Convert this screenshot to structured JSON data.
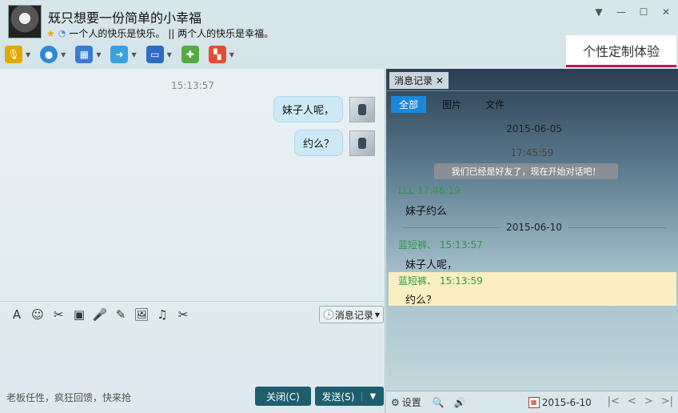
{
  "header": {
    "title": "兓只想要一份简单的小幸福",
    "signature": "一个人的快乐是快乐。  ||  两个人的快乐是幸福。",
    "window_buttons": [
      "▼",
      "—",
      "☐",
      "✕"
    ]
  },
  "toolbar": {
    "items": [
      {
        "name": "voice-call",
        "icon": "🎙",
        "color": "#e0a800"
      },
      {
        "name": "video-call",
        "icon": "●",
        "color": "#2e8bd6"
      },
      {
        "name": "screen-share",
        "icon": "▦",
        "color": "#3b7bd1"
      },
      {
        "name": "file-transfer",
        "icon": "➜",
        "color": "#3aa0e0"
      },
      {
        "name": "remote-assist",
        "icon": "▭",
        "color": "#2b6cc4"
      },
      {
        "name": "group-chat",
        "icon": "✚",
        "color": "#55aa44"
      },
      {
        "name": "apps",
        "icon": "▚",
        "color": "#e05030"
      }
    ],
    "custom_tab": "个性定制体验"
  },
  "chat": {
    "timestamp": "15:13:57",
    "messages": [
      {
        "text": "妹子人呢，"
      },
      {
        "text": "约么？"
      }
    ]
  },
  "editor": {
    "tools": [
      "A",
      "☺",
      "✂",
      "▣",
      "🎤",
      "✎",
      "🖼",
      "♫",
      "✂"
    ],
    "history_button": "消息记录",
    "tagline": "老板任性，疯狂回馈，快来抢",
    "close_label": "关闭(C)",
    "send_label": "发送(S)"
  },
  "history": {
    "tab_label": "消息记录",
    "filters": [
      "全部",
      "图片",
      "文件"
    ],
    "date1": "2015-06-05",
    "time1": "17:45:59",
    "system_msg": "我们已经是好友了，现在开始对话吧！",
    "sender1": "LLL 17:46:19",
    "msg1": "妹子约么",
    "date2": "2015-06-10",
    "sender2": "蓝短裤、 15:13:57",
    "msg2": "妹子人呢，",
    "sender3": "蓝短裤、 15:13:59",
    "msg3": "约么？",
    "settings_label": "设置",
    "current_date": "2015-6-10"
  }
}
